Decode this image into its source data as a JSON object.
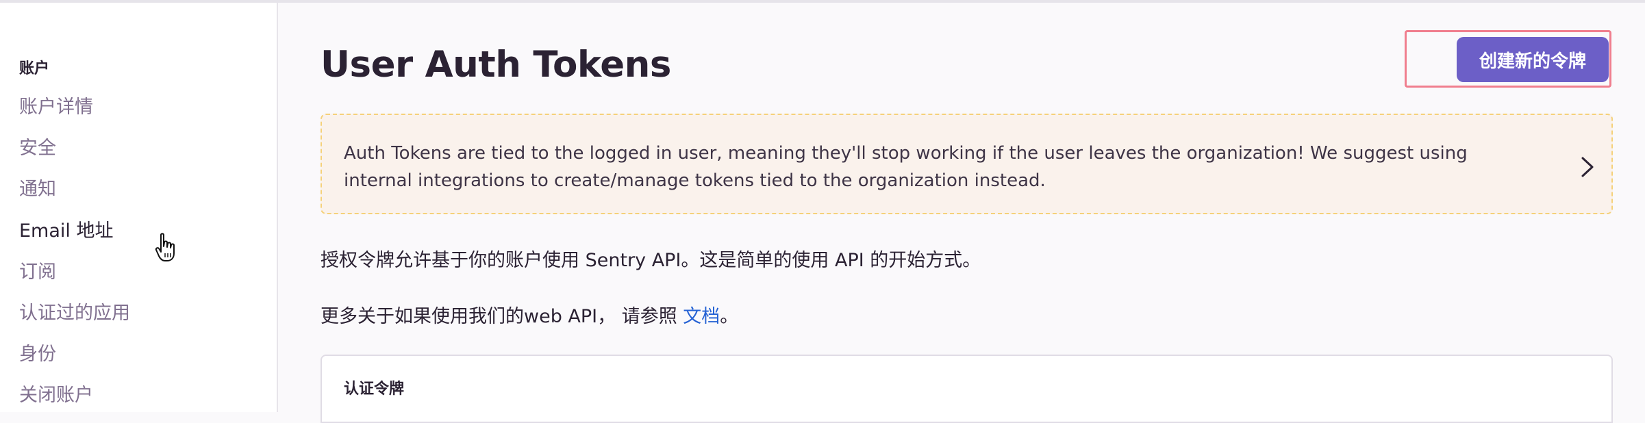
{
  "sidebar": {
    "heading": "账户",
    "items": [
      {
        "label": "账户详情"
      },
      {
        "label": "安全"
      },
      {
        "label": "通知"
      },
      {
        "label": "Email 地址"
      },
      {
        "label": "订阅"
      },
      {
        "label": "认证过的应用"
      },
      {
        "label": "身份"
      },
      {
        "label": "关闭账户"
      }
    ]
  },
  "header": {
    "title": "User Auth Tokens",
    "create_button": "创建新的令牌"
  },
  "alert": {
    "message": "Auth Tokens are tied to the logged in user, meaning they'll stop working if the user leaves the organization! We suggest using internal integrations to create/manage tokens tied to the organization instead."
  },
  "body": {
    "intro": "授权令牌允许基于你的账户使用 Sentry API。这是简单的使用 API 的开始方式。",
    "more_prefix": "更多关于如果使用我们的web API， 请参照 ",
    "docs_link": "文档",
    "more_suffix": "。"
  },
  "panel": {
    "title": "认证令牌"
  },
  "colors": {
    "accent": "#6c5fc7",
    "highlight": "#f07e8e",
    "alert_bg": "#faf2ec",
    "alert_border": "#f5d17a",
    "link": "#2562d4"
  }
}
